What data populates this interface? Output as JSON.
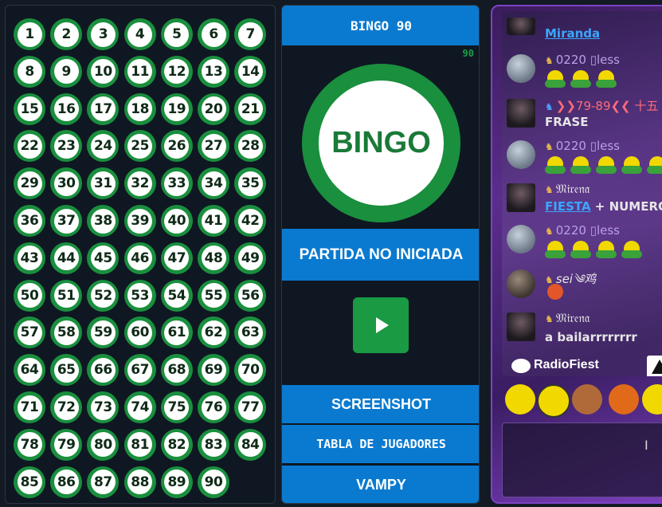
{
  "board": {
    "numbers": [
      "1",
      "2",
      "3",
      "4",
      "5",
      "6",
      "7",
      "8",
      "9",
      "10",
      "11",
      "12",
      "13",
      "14",
      "15",
      "16",
      "17",
      "18",
      "19",
      "20",
      "21",
      "22",
      "23",
      "24",
      "25",
      "26",
      "27",
      "28",
      "29",
      "30",
      "31",
      "32",
      "33",
      "34",
      "35",
      "36",
      "37",
      "38",
      "39",
      "40",
      "41",
      "42",
      "43",
      "44",
      "45",
      "46",
      "47",
      "48",
      "49",
      "50",
      "51",
      "52",
      "53",
      "54",
      "55",
      "56",
      "57",
      "58",
      "59",
      "60",
      "61",
      "62",
      "63",
      "64",
      "65",
      "66",
      "67",
      "68",
      "69",
      "70",
      "71",
      "72",
      "73",
      "74",
      "75",
      "76",
      "77",
      "78",
      "79",
      "80",
      "81",
      "82",
      "83",
      "84",
      "85",
      "86",
      "87",
      "88",
      "89",
      "90"
    ]
  },
  "game": {
    "title": "BINGO 90",
    "count": "90",
    "ball_text": "BINGO",
    "status": "PARTIDA NO INICIADA",
    "screenshot_label": "SCREENSHOT",
    "players_label": "TABLA DE JUGADORES",
    "vampy_label": "VAMPY"
  },
  "chat": {
    "messages": [
      {
        "user": "Miranda",
        "text": ""
      },
      {
        "user": "0220 ▯less",
        "text": ""
      },
      {
        "user": "❯❯79-89❮❮ 十五",
        "text": "FRASE"
      },
      {
        "user": "0220 ▯less",
        "text": ""
      },
      {
        "user": "𝔐𝔦𝔯𝔢𝔫𝔞",
        "link": "FIESTA",
        "text": " + NUMERO"
      },
      {
        "user": "0220 ▯less",
        "text": ""
      },
      {
        "user": "sei༄鸡",
        "text": ""
      },
      {
        "user": "𝔐𝔦𝔯𝔢𝔫𝔞",
        "text": "a bailarrrrrrrr"
      }
    ],
    "radio_label": "RadioFiest",
    "input_cursor": "I",
    "colors": {
      "accent": "#0a7ad0",
      "green": "#1a8f3e",
      "chat_purple": "#5b2d8c"
    }
  }
}
